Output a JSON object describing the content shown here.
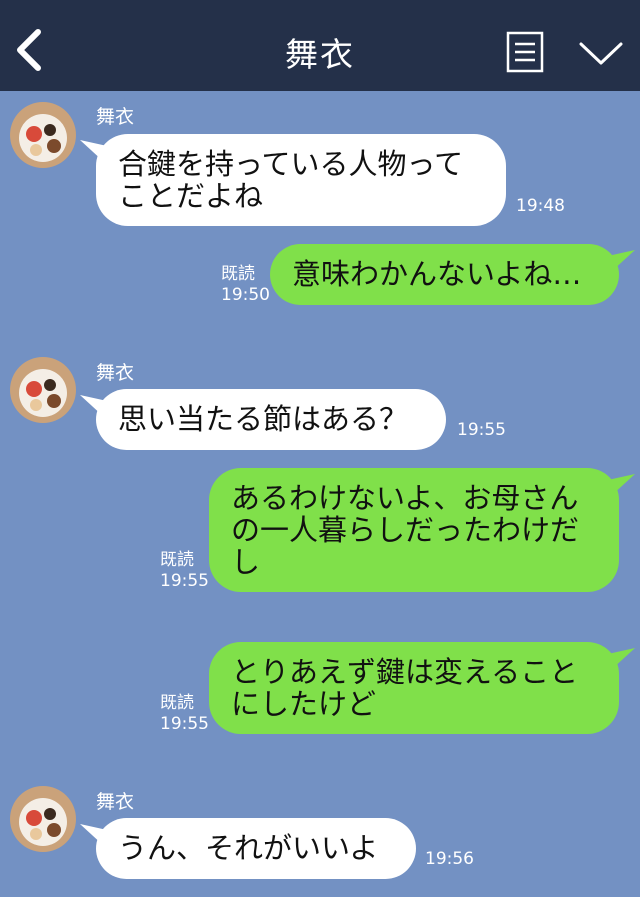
{
  "header": {
    "title": "舞衣",
    "back_icon": "chevron-left-icon",
    "note_icon": "note-icon",
    "menu_icon": "chevron-down-icon"
  },
  "messages": [
    {
      "side": "left",
      "sender": "舞衣",
      "text": "合鍵を持っている人物ってことだよね",
      "time": "19:48"
    },
    {
      "side": "right",
      "read": "既読",
      "text": "意味わかんないよね…",
      "time": "19:50"
    },
    {
      "side": "left",
      "sender": "舞衣",
      "text": "思い当たる節はある？",
      "time": "19:55"
    },
    {
      "side": "right",
      "read": "既読",
      "text": "あるわけないよ、お母さんの一人暮らしだったわけだし",
      "time": "19:55"
    },
    {
      "side": "right",
      "read": "既読",
      "text": "とりあえず鍵は変えることにしたけど",
      "time": "19:55"
    },
    {
      "side": "left",
      "sender": "舞衣",
      "text": "うん、それがいいよ",
      "time": "19:56"
    }
  ],
  "colors": {
    "background": "#7391c3",
    "header": "#243049",
    "bubble_left": "#ffffff",
    "bubble_right": "#80e04a"
  }
}
